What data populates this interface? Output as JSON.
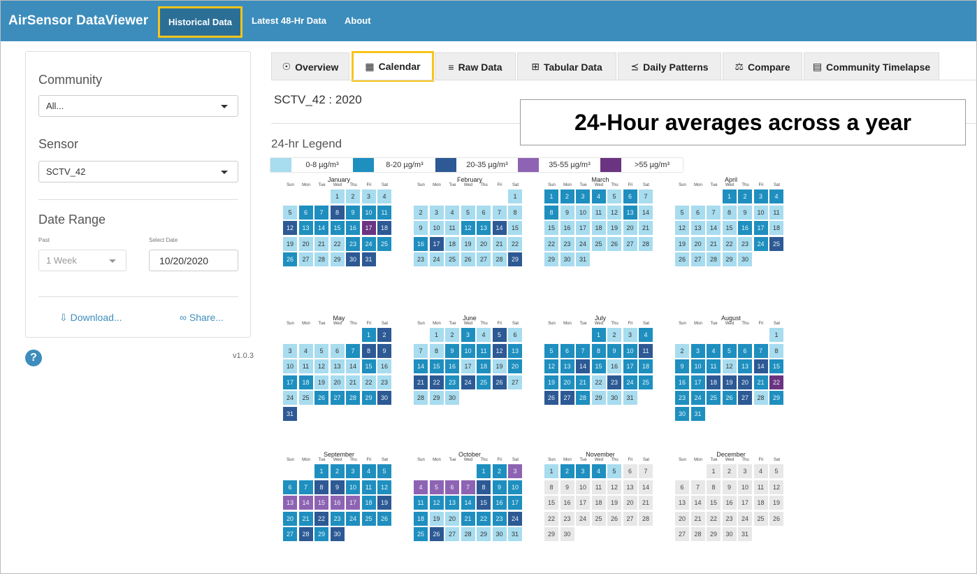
{
  "header": {
    "brand": "AirSensor DataViewer",
    "nav": [
      "Historical Data",
      "Latest 48-Hr Data",
      "About"
    ]
  },
  "sidebar": {
    "community_label": "Community",
    "community_value": "All...",
    "sensor_label": "Sensor",
    "sensor_value": "SCTV_42",
    "date_range_label": "Date Range",
    "past_label": "Past",
    "past_value": "1 Week",
    "select_date_label": "Select Date",
    "select_date_value": "10/20/2020",
    "download_label": "Download...",
    "share_label": "Share...",
    "version": "v1.0.3",
    "help": "?"
  },
  "tabs": [
    {
      "label": "Overview",
      "icon": "binoculars-icon",
      "glyph": "☉"
    },
    {
      "label": "Calendar",
      "icon": "calendar-icon",
      "glyph": "▦"
    },
    {
      "label": "Raw Data",
      "icon": "database-icon",
      "glyph": "≡"
    },
    {
      "label": "Tabular Data",
      "icon": "table-icon",
      "glyph": "⊞"
    },
    {
      "label": "Daily Patterns",
      "icon": "bar-chart-icon",
      "glyph": "⪯"
    },
    {
      "label": "Compare",
      "icon": "balance-scale-icon",
      "glyph": "⚖"
    },
    {
      "label": "Community Timelapse",
      "icon": "file-icon",
      "glyph": "▤"
    }
  ],
  "main": {
    "sensor_header": "SCTV_42 : 2020",
    "callout": "24-Hour averages across a year",
    "legend_title": "24-hr Legend"
  },
  "legend": [
    {
      "label": "0-8 µg/m³",
      "color": "#a8dcef"
    },
    {
      "label": "8-20 µg/m³",
      "color": "#1e8fbf"
    },
    {
      "label": "20-35 µg/m³",
      "color": "#2d5994"
    },
    {
      "label": "35-55 µg/m³",
      "color": "#8e63b3"
    },
    {
      "label": ">55 µg/m³",
      "color": "#6a3480"
    }
  ],
  "nodata_color": "#e8e8e8",
  "dow_labels": [
    "Sun",
    "Mon",
    "Tue",
    "Wed",
    "Thu",
    "Fri",
    "Sat"
  ],
  "calendar": {
    "year": 2020,
    "months": [
      {
        "name": "January",
        "start": 3,
        "days": 31,
        "levels": "00000112111211114200001111000223220000000000000000"
      },
      {
        "name": "February",
        "start": 6,
        "days": 29,
        "levels": "00000000000112012000000000002100000000000000000000"
      },
      {
        "name": "March",
        "start": 0,
        "days": 31,
        "levels": "11110101000010000000000000000000000000000000000000"
      },
      {
        "name": "April",
        "start": 3,
        "days": 30,
        "levels": "11110000000000011000000120000002200000000000000000"
      },
      {
        "name": "May",
        "start": 5,
        "days": 31,
        "levels": "12000012200000101100000001111222100000000000000000"
      },
      {
        "name": "June",
        "start": 1,
        "days": 30,
        "levels": "00102000111211110101221212000000000000000000000000"
      },
      {
        "name": "July",
        "start": 3,
        "days": 31,
        "levels": "10011111112112101111102112210000000000000000000000"
      },
      {
        "name": "August",
        "start": 6,
        "days": 31,
        "levels": "00111110111012111222141111201111100000000000000000"
      },
      {
        "name": "September",
        "start": 2,
        "days": 30,
        "levels": "11111112211133333121121111121222000000000000000000"
      },
      {
        "name": "October",
        "start": 4,
        "days": 31,
        "levels": "11333332111111211100111212000000000000000000000000"
      },
      {
        "name": "November",
        "start": 0,
        "days": 30,
        "levels": "01110999999999999999999999999999900000000000000000"
      },
      {
        "name": "December",
        "start": 2,
        "days": 31,
        "levels": "99999999999999999999999999999999900000000000000000"
      }
    ]
  }
}
